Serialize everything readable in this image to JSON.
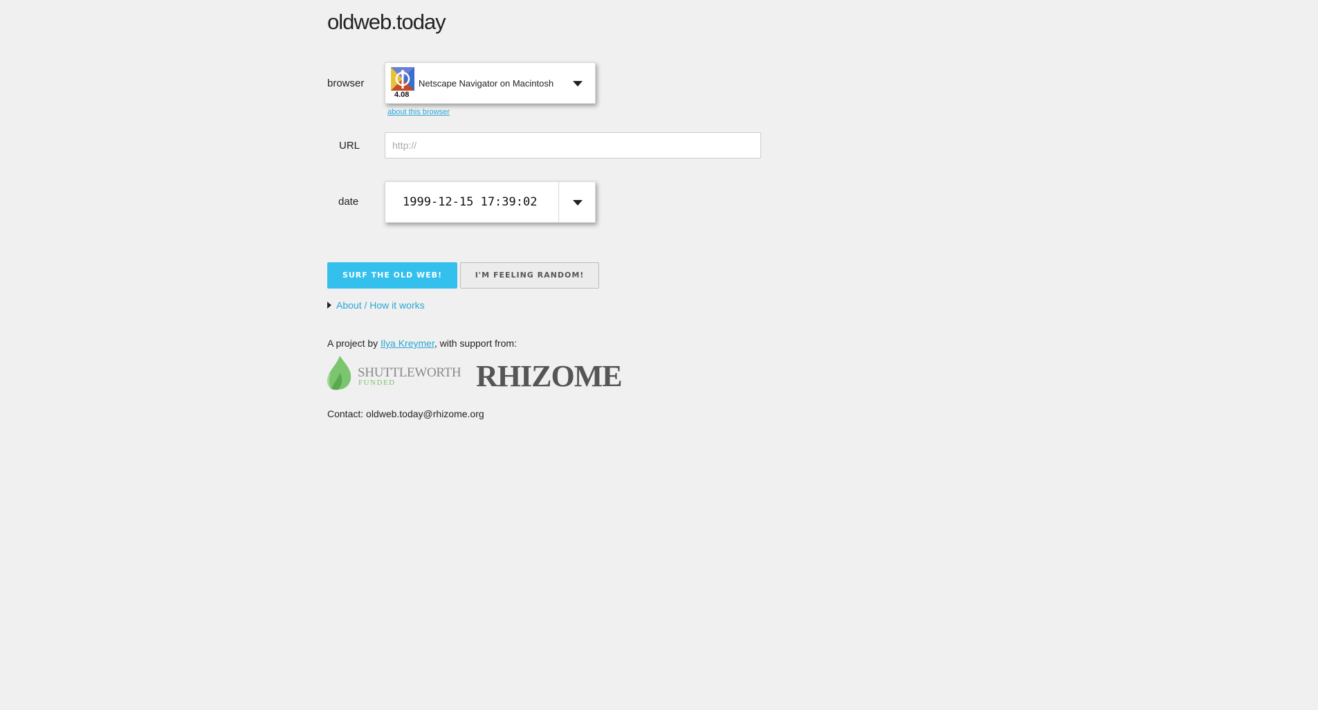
{
  "site": {
    "title": "oldweb.today"
  },
  "browser_field": {
    "label": "browser",
    "selected_name": "Netscape Navigator on Macintosh",
    "selected_version": "4.08",
    "icon": "netscape-navigator-icon",
    "about_link": "about this browser"
  },
  "url_field": {
    "label": "URL",
    "value": "",
    "placeholder": "http://"
  },
  "date_field": {
    "label": "date",
    "value": "1999-12-15 17:39:02"
  },
  "buttons": {
    "surf": "SURF THE OLD WEB!",
    "random": "I'M FEELING RANDOM!"
  },
  "about": {
    "toggle_label": "About / How it works"
  },
  "credits": {
    "prefix": "A project by ",
    "author": "Ilya Kreymer",
    "suffix": ", with support from:",
    "sponsors": {
      "shuttleworth_name": "SHUTTLEWORTH",
      "shuttleworth_sub": "FUNDED",
      "rhizome": "RHIZOME"
    },
    "contact": "Contact: oldweb.today@rhizome.org"
  },
  "colors": {
    "accent": "#34c0ed",
    "link": "#2aa6d6",
    "background": "#f0f0f0",
    "shuttleworth_green": "#77c36a"
  }
}
